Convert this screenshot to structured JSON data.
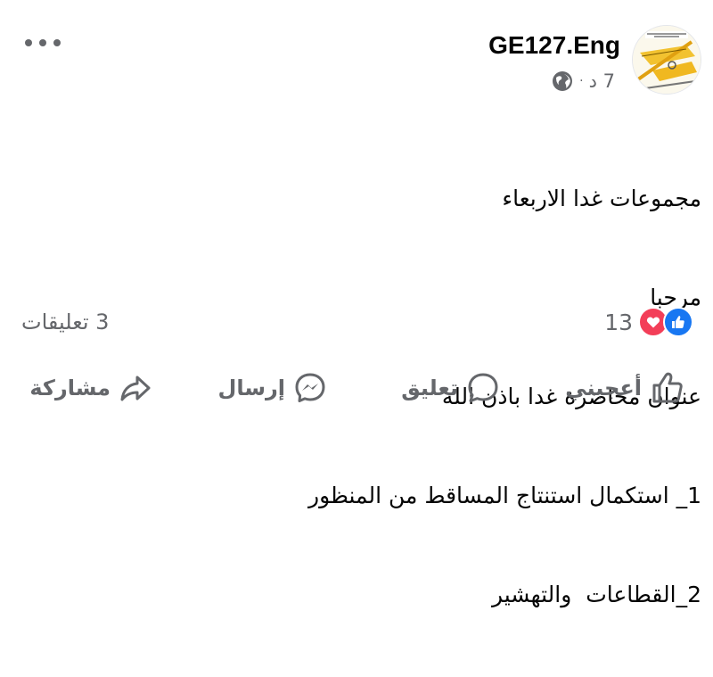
{
  "header": {
    "page_name": "GE127.Eng",
    "time": "7 د",
    "separator": "·",
    "avatar_icon": "drafting-tools-avatar",
    "privacy_icon": "globe-icon",
    "more_icon": "more-options-icon"
  },
  "post": {
    "lines": [
      "مجموعات غدا الاربعاء",
      "مرحبا",
      "عنوان محاضرة غدا باذن الله",
      "1_ استكمال استنتاج المساقط من المنظور",
      "2_القطاعات  والتهشير"
    ]
  },
  "stats": {
    "reactions_count": "13",
    "comments_count": "3 تعليقات",
    "reaction_icons": [
      "like-reaction-icon",
      "love-reaction-icon"
    ]
  },
  "actions": {
    "like_label": "أعجبني",
    "comment_label": "تعليق",
    "send_label": "إرسال",
    "share_label": "مشاركة"
  },
  "colors": {
    "secondary_text": "#65676b",
    "like_blue": "#1877f2",
    "love_red": "#f33e58"
  }
}
